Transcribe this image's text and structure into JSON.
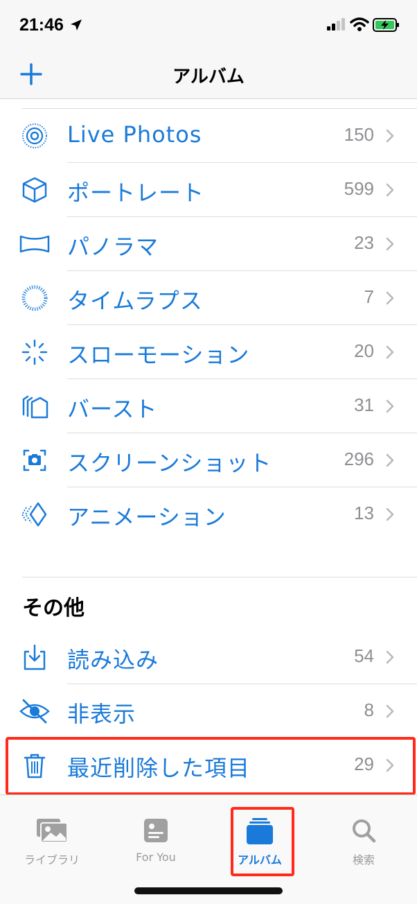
{
  "status": {
    "time": "21:46"
  },
  "nav": {
    "title": "アルバム"
  },
  "media_types": [
    {
      "label": "Live Photos",
      "count": "150",
      "icon": "live-photos-icon"
    },
    {
      "label": "ポートレート",
      "count": "599",
      "icon": "portrait-cube-icon"
    },
    {
      "label": "パノラマ",
      "count": "23",
      "icon": "panorama-icon"
    },
    {
      "label": "タイムラプス",
      "count": "7",
      "icon": "timelapse-icon"
    },
    {
      "label": "スローモーション",
      "count": "20",
      "icon": "slomo-icon"
    },
    {
      "label": "バースト",
      "count": "31",
      "icon": "burst-icon"
    },
    {
      "label": "スクリーンショット",
      "count": "296",
      "icon": "screenshot-icon"
    },
    {
      "label": "アニメーション",
      "count": "13",
      "icon": "animation-icon"
    }
  ],
  "other": {
    "title": "その他",
    "items": [
      {
        "label": "読み込み",
        "count": "54",
        "icon": "import-icon"
      },
      {
        "label": "非表示",
        "count": "8",
        "icon": "hidden-eye-icon"
      },
      {
        "label": "最近削除した項目",
        "count": "29",
        "icon": "trash-icon"
      }
    ]
  },
  "tabs": [
    {
      "label": "ライブラリ",
      "icon": "library-icon",
      "active": false
    },
    {
      "label": "For You",
      "icon": "for-you-icon",
      "active": false
    },
    {
      "label": "アルバム",
      "icon": "albums-icon",
      "active": true
    },
    {
      "label": "検索",
      "icon": "search-icon",
      "active": false
    }
  ],
  "colors": {
    "accent": "#1a7ad9",
    "count": "#8e8e93",
    "highlight": "#ff2a1a"
  }
}
